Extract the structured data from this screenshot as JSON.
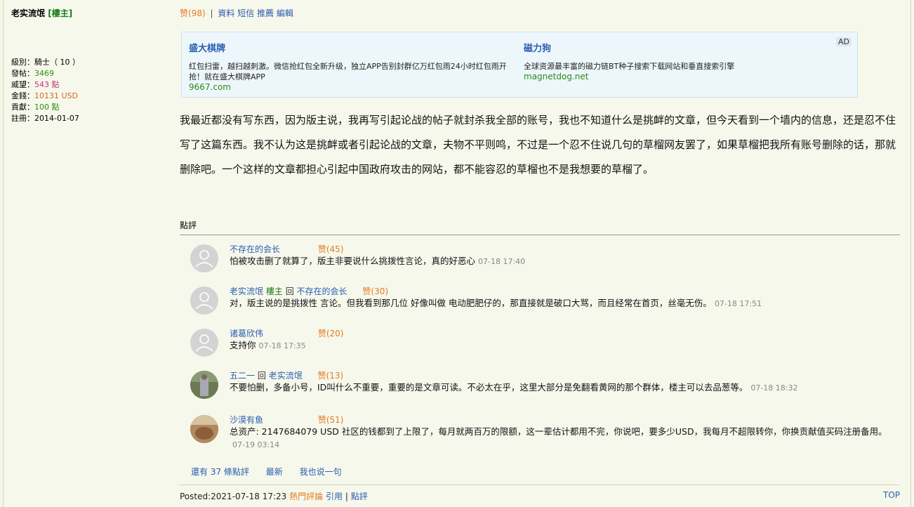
{
  "sidebar": {
    "author": "老实流氓",
    "author_badge": "[樓主]",
    "stats": [
      {
        "label": "級別：",
        "value": "騎士（ 10 ）"
      },
      {
        "label": "發帖：",
        "value": "3469"
      },
      {
        "label": "威望：",
        "value": "543 點"
      },
      {
        "label": "金錢：",
        "value": "10131 USD"
      },
      {
        "label": "貢獻：",
        "value": "100 點"
      },
      {
        "label": "註冊：",
        "value": "2014-01-07"
      }
    ]
  },
  "topbar": {
    "like": "赞(98)",
    "sep": "|",
    "links": [
      "資料",
      "短信",
      "推薦",
      "編輯"
    ]
  },
  "ad": {
    "tag": "AD",
    "items": [
      {
        "title": "盛大棋牌",
        "desc": "红包扫雷，越扫越刺激。微信抢红包全新升级，独立APP告别封群亿万红包雨24小时红包雨开抢！就在盛大棋牌APP",
        "url": "9667.com"
      },
      {
        "title": "磁力狗",
        "desc": "全球资源最丰富的磁力链BT种子搜索下载网站和垂直搜索引擎",
        "url": "magnetdog.net"
      }
    ]
  },
  "post": {
    "text": "我最近都没有写东西，因为版主说，我再写引起论战的帖子就封杀我全部的账号，我也不知道什么是挑衅的文章，但今天看到一个墙内的信息，还是忍不住写了这篇东西。我不认为这是挑衅或者引起论战的文章，夫物不平则鸣，不过是一个忍不住说几句的草榴网友罢了，如果草榴把我所有账号删除的话，那就删除吧。一个这样的文章都担心引起中国政府攻击的网站，都不能容忍的草榴也不是我想要的草榴了。"
  },
  "comments": {
    "title": "點評",
    "items": [
      {
        "user": "不存在的会长",
        "mod": "",
        "reply_word": "",
        "reply_to": "",
        "like": "赞(45)",
        "text": "怕被攻击删了就算了，版主非要说什么挑拨性言论，真的好恶心",
        "time": "07-18 17:40"
      },
      {
        "user": "老实流氓",
        "mod": "樓主",
        "reply_word": "回",
        "reply_to": "不存在的会长",
        "like": "赞(30)",
        "text": "对，版主说的是挑拨性 言论。但我看到那几位 好像叫做 电动肥肥仔的，那直接就是破口大骂，而且经常在首页，丝毫无伤。",
        "time": "07-18 17:51"
      },
      {
        "user": "诸葛欣伟",
        "mod": "",
        "reply_word": "",
        "reply_to": "",
        "like": "赞(20)",
        "text": "支持你",
        "time": "07-18 17:35"
      },
      {
        "user": "五二一",
        "mod": "",
        "reply_word": "回",
        "reply_to": "老实流氓",
        "like": "赞(13)",
        "text": "不要怕删，多备小号，ID叫什么不重要，重要的是文章可读。不必太在乎，这里大部分是免翻看黄网的那个群体，楼主可以去品葱等。",
        "time": "07-18 18:32"
      },
      {
        "user": "沙漠有鱼",
        "mod": "",
        "reply_word": "",
        "reply_to": "",
        "like": "赞(51)",
        "text": "总资产: 2147684079 USD 社区的钱都到了上限了，每月就两百万的限额，这一辈估计都用不完，你说吧，要多少USD，我每月不超限转你，你换贡献值买码注册备用。",
        "time": "07-19 03:14"
      }
    ],
    "more": [
      "還有 37 條點評",
      "最新",
      "我也说一句"
    ]
  },
  "footer": {
    "posted": "Posted:2021-07-18 17:23",
    "hot": "熱門評論",
    "quote": "引用",
    "sep": "|",
    "comment": "點評",
    "top": "TOP"
  },
  "colors": {
    "background": "#f7f8ec",
    "link": "#2a5db0",
    "like": "#e07b22",
    "moderator": "#1a7a1a"
  }
}
